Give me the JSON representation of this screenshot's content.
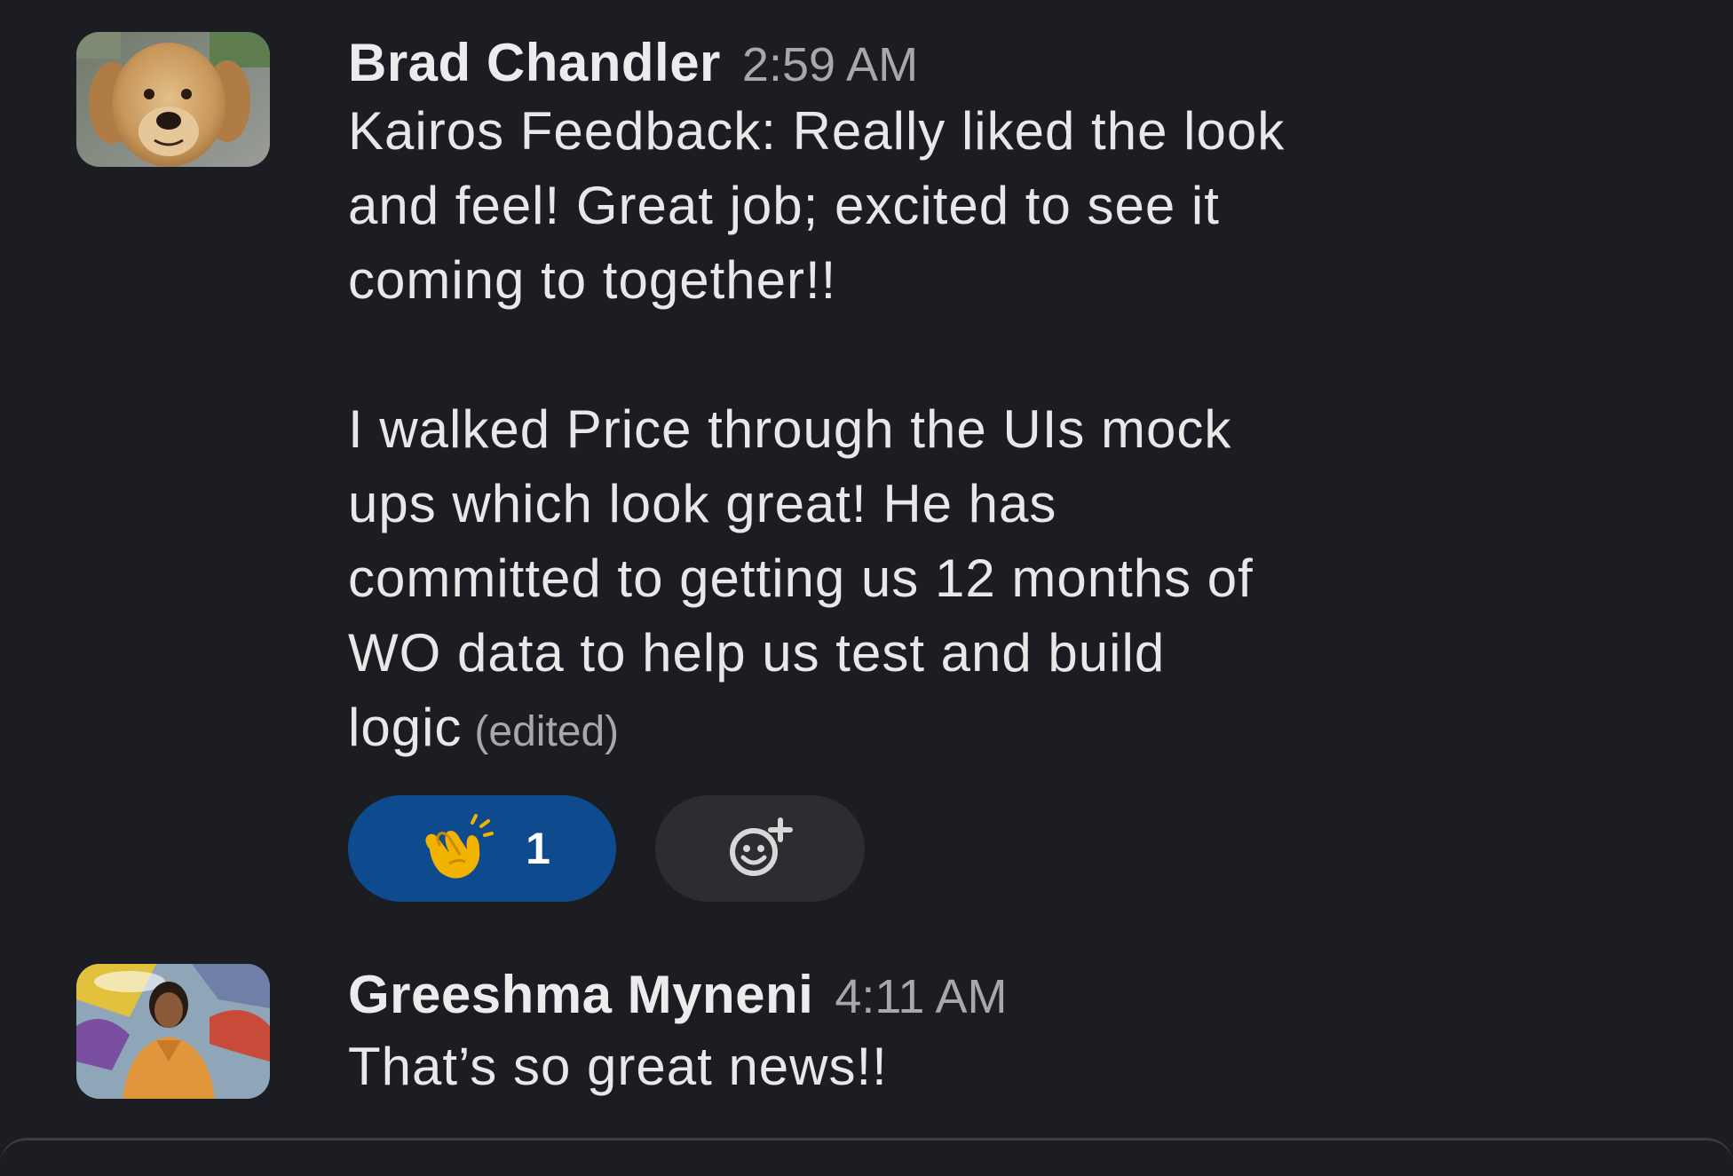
{
  "messages": [
    {
      "author": "Brad Chandler",
      "time": "2:59 AM",
      "lines": [
        "Kairos Feedback:  Really liked the look",
        "and feel!  Great job; excited to see it",
        "coming to together!!",
        "",
        "I walked Price through the UIs mock",
        "ups which look great!  He has",
        "committed to getting us 12 months of",
        "WO data to help us test and build",
        "logic"
      ],
      "edited_label": "(edited)",
      "reactions": [
        {
          "emoji_icon": "clapping-hands-icon",
          "count": "1"
        }
      ],
      "add_reaction_icon": "add-reaction-icon"
    },
    {
      "author": "Greeshma Myneni",
      "time": "4:11 AM",
      "lines": [
        "That’s so great news!!"
      ]
    }
  ],
  "colors": {
    "background": "#1b1d22",
    "reaction_active": "#0d4b8e",
    "reaction_idle": "#2b2d31",
    "muted_text": "#a6a8ab"
  }
}
